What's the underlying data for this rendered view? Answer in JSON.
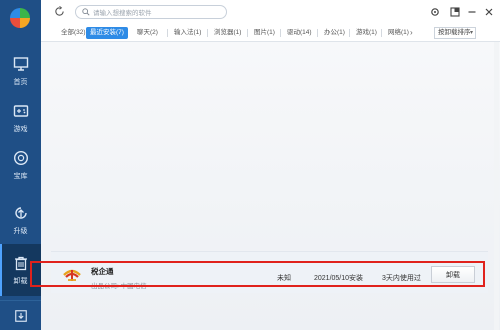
{
  "search": {
    "placeholder": "请输入想搜索的软件"
  },
  "tabs": [
    {
      "label": "全部(32)"
    },
    {
      "label": "最近安装(7)"
    },
    {
      "label": "聊天(2)"
    },
    {
      "label": "输入法(1)"
    },
    {
      "label": "浏览器(1)"
    },
    {
      "label": "图片(1)"
    },
    {
      "label": "驱动(14)"
    },
    {
      "label": "办公(1)"
    },
    {
      "label": "游戏(1)"
    },
    {
      "label": "网络(1)"
    }
  ],
  "sort": {
    "label": "按卸载排序"
  },
  "sidebar": {
    "items": [
      {
        "label": "首页",
        "icon": "monitor-icon"
      },
      {
        "label": "游戏",
        "icon": "gamepad-icon"
      },
      {
        "label": "宝库",
        "icon": "vault-icon"
      },
      {
        "label": "升级",
        "icon": "upgrade-icon"
      },
      {
        "label": "卸载",
        "icon": "trash-icon"
      }
    ]
  },
  "app_row": {
    "name": "税企通",
    "publisher": "出品公司: 中国电信",
    "size": "未知",
    "install_date": "2021/05/10安装",
    "usage": "3天内使用过",
    "uninstall_label": "卸载"
  },
  "colors": {
    "sidebar": "#1f4f86",
    "accent": "#2e8be6",
    "highlight": "#e0221c"
  }
}
